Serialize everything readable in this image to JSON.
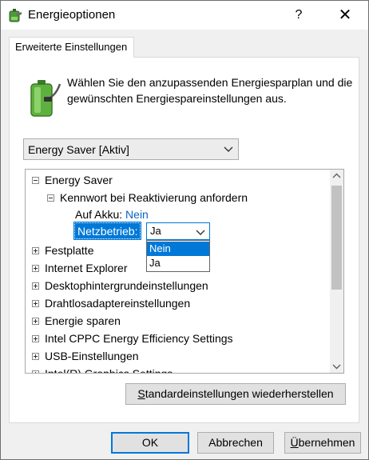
{
  "window": {
    "title": "Energieoptionen",
    "help_label": "?",
    "close_label": "✕"
  },
  "tab": {
    "label": "Erweiterte Einstellungen"
  },
  "intro": {
    "text": "Wählen Sie den anzupassenden Energiesparplan und die gewünschten Energiespareinstellungen aus."
  },
  "plan_select": {
    "value": "Energy Saver [Aktiv]"
  },
  "tree": {
    "root": "Energy Saver",
    "sub": "Kennwort bei Reaktivierung anfordern",
    "akku_label": "Auf Akku:",
    "akku_value": "Nein",
    "netz_label": "Netzbetrieb:",
    "netz_value": "Ja",
    "dropdown_options": [
      "Nein",
      "Ja"
    ],
    "items": [
      "Festplatte",
      "Internet Explorer",
      "Desktophintergrundeinstellungen",
      "Drahtlosadaptereinstellungen",
      "Energie sparen",
      "Intel CPPC Energy Efficiency Settings",
      "USB-Einstellungen",
      "Intel(R) Graphics Settings"
    ]
  },
  "restore_button": {
    "mnemonic": "S",
    "rest": "tandardeinstellungen wiederherstellen"
  },
  "buttons": {
    "ok": "OK",
    "cancel": "Abbrechen",
    "apply_mnemonic": "Ü",
    "apply_rest": "bernehmen"
  },
  "colors": {
    "accent": "#0078d7",
    "link": "#0a66c2",
    "dialog_bg": "#f0f0f0"
  }
}
